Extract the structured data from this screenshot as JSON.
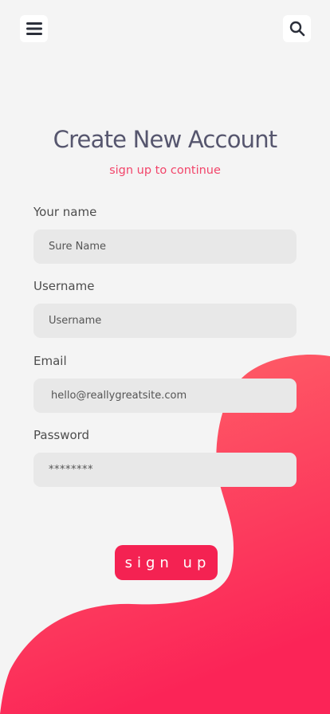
{
  "colors": {
    "background": "#f4f4f4",
    "accent": "#f42252",
    "blob_gradient_start": "#ff6a6a",
    "blob_gradient_end": "#fb2457",
    "title": "#56566e",
    "subtitle": "#f2456a",
    "field_background": "#e8e8e8"
  },
  "header": {
    "menu_icon": "hamburger-icon",
    "search_icon": "search-icon"
  },
  "page": {
    "title": "Create New Account",
    "subtitle": "sign up to continue"
  },
  "form": {
    "name": {
      "label": "Your name",
      "placeholder": "Sure Name"
    },
    "username": {
      "label": "Username",
      "placeholder": "Username"
    },
    "email": {
      "label": "Email",
      "value": "hello@reallygreatsite.com"
    },
    "password": {
      "label": "Password",
      "value": "********"
    }
  },
  "signup_button": {
    "label": "sign up"
  }
}
